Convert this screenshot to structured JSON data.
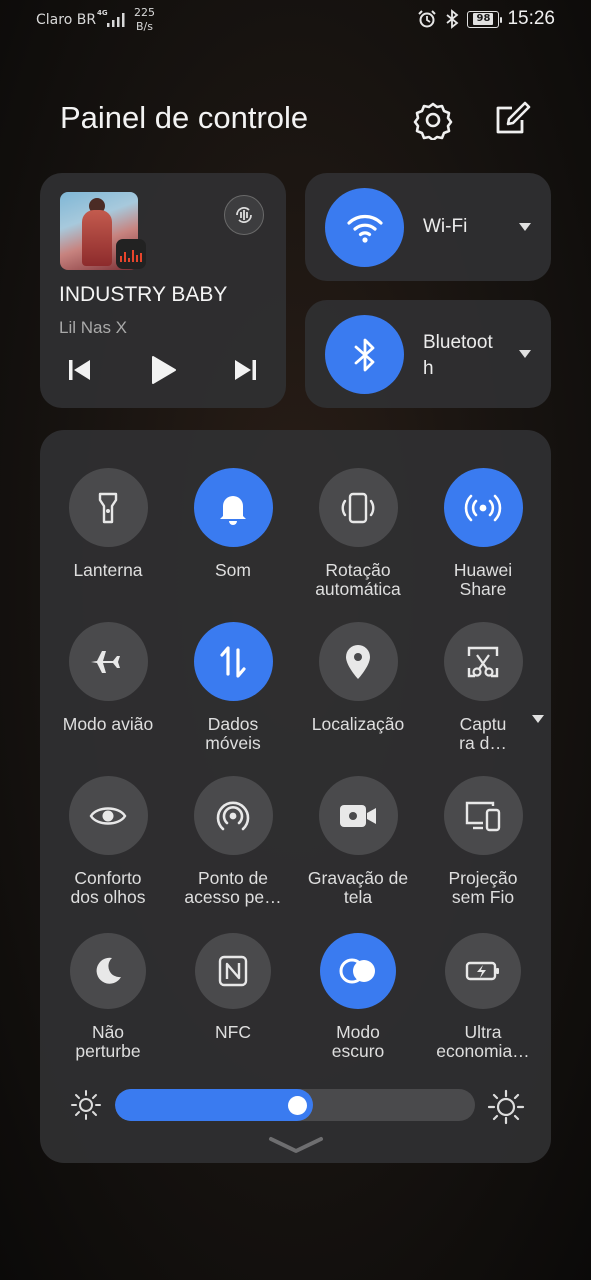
{
  "status": {
    "carrier": "Claro BR",
    "network": "4G",
    "speed_value": "225",
    "speed_unit": "B/s",
    "battery": "98",
    "time": "15:26"
  },
  "header": {
    "title": "Painel de controle"
  },
  "media": {
    "song": "INDUSTRY BABY",
    "artist": "Lil Nas X"
  },
  "wifi": {
    "label": "Wi-Fi"
  },
  "bluetooth": {
    "label": "Bluetoot\nh"
  },
  "tiles": [
    {
      "label": "Lanterna",
      "icon": "flashlight-icon",
      "active": false
    },
    {
      "label": "Som",
      "icon": "bell-icon",
      "active": true
    },
    {
      "label": "Rotação\nautomática",
      "icon": "rotation-icon",
      "active": false
    },
    {
      "label": "Huawei\nShare",
      "icon": "share-icon",
      "active": true
    },
    {
      "label": "Modo avião",
      "icon": "airplane-icon",
      "active": false
    },
    {
      "label": "Dados\nmóveis",
      "icon": "mobile-data-icon",
      "active": true
    },
    {
      "label": "Localização",
      "icon": "location-icon",
      "active": false
    },
    {
      "label": "Captu\nra d…",
      "icon": "screenshot-icon",
      "active": false
    },
    {
      "label": "Conforto\ndos olhos",
      "icon": "eye-icon",
      "active": false
    },
    {
      "label": "Ponto de\nacesso pe…",
      "icon": "hotspot-icon",
      "active": false
    },
    {
      "label": "Gravação de\ntela",
      "icon": "video-record-icon",
      "active": false
    },
    {
      "label": "Projeção\nsem Fio",
      "icon": "projection-icon",
      "active": false
    },
    {
      "label": "Não\nperturbe",
      "icon": "moon-icon",
      "active": false
    },
    {
      "label": "NFC",
      "icon": "nfc-icon",
      "active": false
    },
    {
      "label": "Modo\nescuro",
      "icon": "dark-mode-icon",
      "active": true
    },
    {
      "label": "Ultra\neconomia…",
      "icon": "battery-saver-icon",
      "active": false
    }
  ],
  "brightness": {
    "level": 0.55
  },
  "colors": {
    "accent": "#3a7bf0",
    "card": "#303032",
    "inactive": "#4a4a4c"
  }
}
